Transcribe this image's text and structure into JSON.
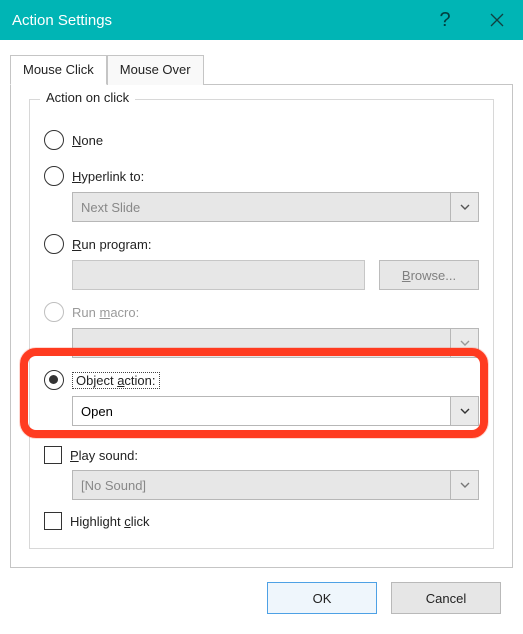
{
  "title": "Action Settings",
  "tabs": {
    "mouse_click": "Mouse Click",
    "mouse_over": "Mouse Over"
  },
  "group_label": "Action on click",
  "options": {
    "none": "None",
    "hyperlink": "Hyperlink to:",
    "hyperlink_value": "Next Slide",
    "run_program": "Run program:",
    "browse_btn": "Browse...",
    "run_macro": "Run macro:",
    "object_action": "Object action:",
    "object_action_value": "Open"
  },
  "checks": {
    "play_sound": "Play sound:",
    "play_sound_value": "[No Sound]",
    "highlight": "Highlight click"
  },
  "footer": {
    "ok": "OK",
    "cancel": "Cancel"
  }
}
